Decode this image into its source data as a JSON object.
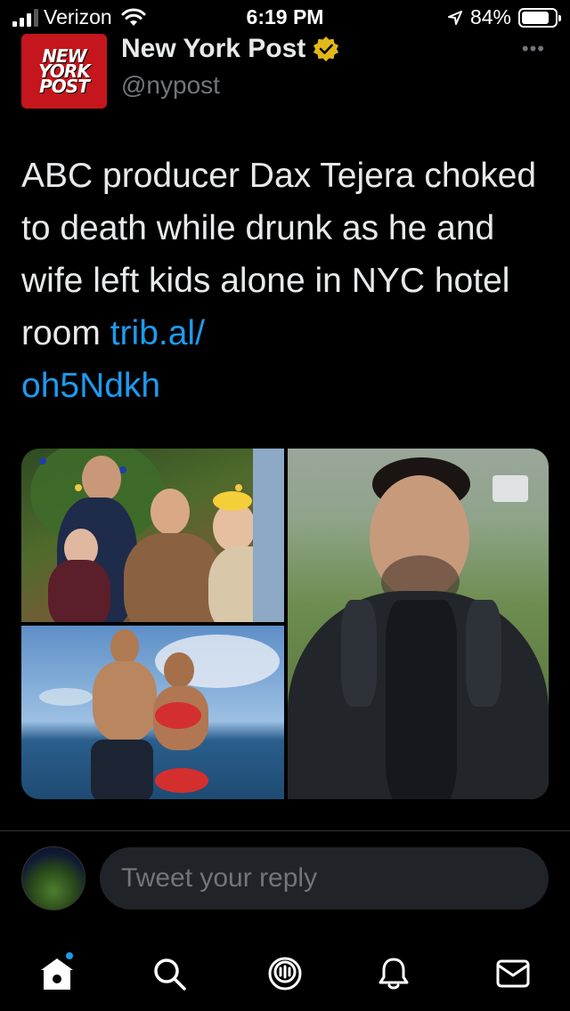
{
  "status_bar": {
    "carrier": "Verizon",
    "time": "6:19 PM",
    "battery_percent": "84%",
    "battery_level": 0.84,
    "signal_bars": 3
  },
  "tweet": {
    "logo_lines": [
      "NEW",
      "YORK",
      "POST"
    ],
    "account_name": "New York Post",
    "verified": true,
    "handle": "@nypost",
    "more_label": "•••",
    "text": "ABC producer Dax Tejera choked to death while drunk as he and wife left kids alone in NYC hotel room",
    "link_line1": "trib.al/",
    "link_line2": "oh5Ndkh"
  },
  "reply": {
    "placeholder": "Tweet your reply"
  },
  "tabs": [
    {
      "name": "home",
      "icon": "home-icon",
      "active": true,
      "has_notification_dot": true
    },
    {
      "name": "search",
      "icon": "search-icon",
      "active": false
    },
    {
      "name": "spaces",
      "icon": "spaces-icon",
      "active": false
    },
    {
      "name": "notifications",
      "icon": "bell-icon",
      "active": false
    },
    {
      "name": "messages",
      "icon": "mail-icon",
      "active": false
    }
  ],
  "colors": {
    "background": "#000000",
    "text": "#e7e9ea",
    "secondary": "#71767b",
    "link": "#1d9bf0",
    "verified_badge": "#e2b719",
    "logo_red": "#c4161c"
  }
}
